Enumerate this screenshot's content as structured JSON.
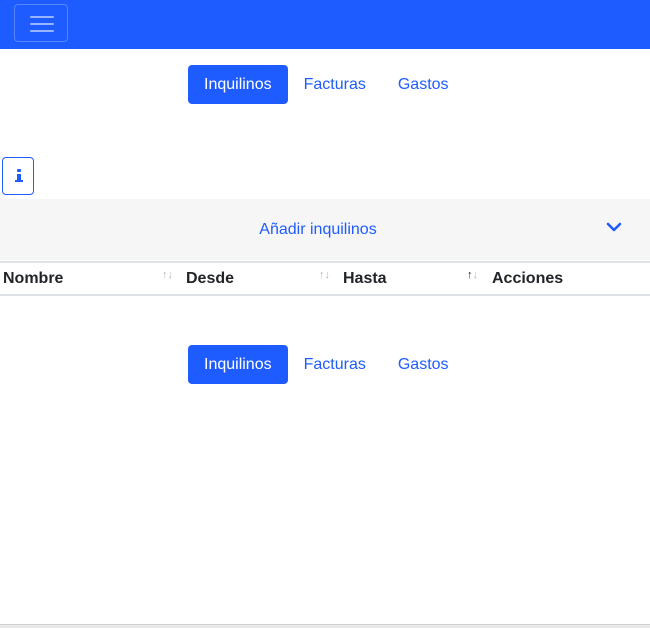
{
  "navbar": {
    "toggler_icon": "hamburger-menu-icon",
    "color": "#1f5cff"
  },
  "top_nav": {
    "tabs": [
      {
        "label": "Inquilinos",
        "active": true
      },
      {
        "label": "Facturas",
        "active": false
      },
      {
        "label": "Gastos",
        "active": false
      }
    ]
  },
  "info_button": {
    "icon": "info-icon"
  },
  "accordion": {
    "title": "Añadir inquilinos",
    "icon": "chevron-down-icon",
    "expanded": false
  },
  "table": {
    "columns": [
      {
        "label": "Nombre"
      },
      {
        "label": "Desde"
      },
      {
        "label": "Hasta"
      },
      {
        "label": "Acciones"
      }
    ],
    "rows": []
  },
  "bottom_nav": {
    "tabs": [
      {
        "label": "Inquilinos",
        "active": true
      },
      {
        "label": "Facturas",
        "active": false
      },
      {
        "label": "Gastos",
        "active": false
      }
    ]
  },
  "colors": {
    "primary": "#1f5cff",
    "accordion_bg": "#f6f6f6"
  }
}
